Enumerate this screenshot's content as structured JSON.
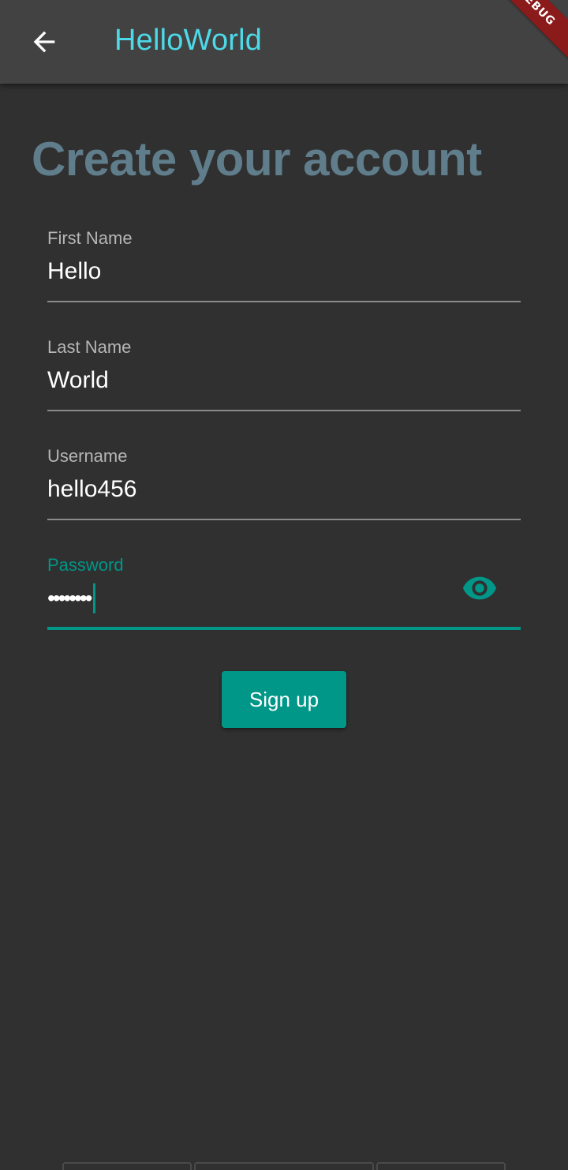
{
  "appbar": {
    "title": "HelloWorld",
    "back_icon": "arrow-back-icon",
    "debug_banner": "DEBUG"
  },
  "page": {
    "heading": "Create your account"
  },
  "form": {
    "first_name": {
      "label": "First Name",
      "value": "Hello"
    },
    "last_name": {
      "label": "Last Name",
      "value": "World"
    },
    "username": {
      "label": "Username",
      "value": "hello456"
    },
    "password": {
      "label": "Password",
      "masked_value": "••••••••",
      "toggle_icon": "eye-icon"
    }
  },
  "actions": {
    "signup_label": "Sign up"
  },
  "colors": {
    "background": "#303030",
    "appbar": "#424242",
    "title": "#4dd9e8",
    "heading": "#607d8b",
    "accent": "#009688",
    "debug_banner": "#8b1a1a"
  }
}
